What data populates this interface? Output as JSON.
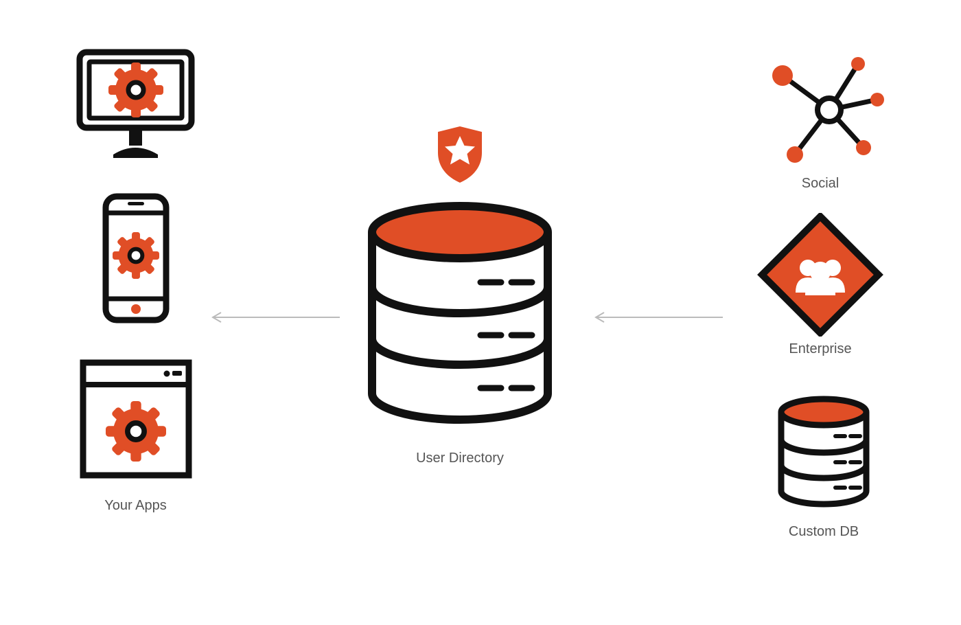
{
  "colors": {
    "accent": "#E04E26",
    "stroke": "#111111",
    "label": "#555555",
    "arrow": "#BBBBBB"
  },
  "left": {
    "label": "Your Apps"
  },
  "center": {
    "label": "User Directory"
  },
  "right": {
    "social": {
      "label": "Social"
    },
    "enterprise": {
      "label": "Enterprise"
    },
    "customdb": {
      "label": "Custom DB"
    }
  }
}
